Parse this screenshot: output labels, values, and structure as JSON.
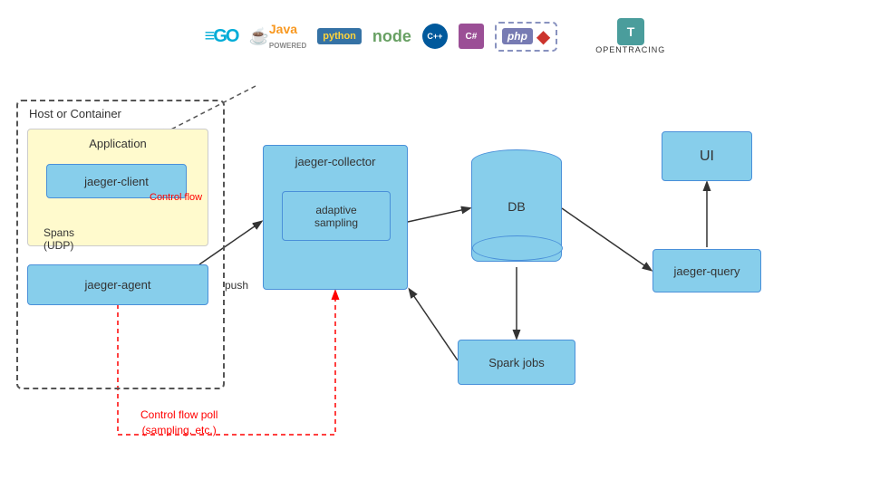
{
  "logos": {
    "go": "≡GO",
    "java": "☕ Java",
    "python": "python",
    "node": "node",
    "cpp": "C++",
    "csharp": "C#",
    "php": "php",
    "ruby": "◆",
    "opentracing": "OPENTRACING"
  },
  "diagram": {
    "host_label": "Host or Container",
    "app_label": "Application",
    "jaeger_client": "jaeger-client",
    "jaeger_agent": "jaeger-agent",
    "spans_label": "Spans\n(UDP)",
    "control_flow": "Control flow",
    "jaeger_collector": "jaeger-collector",
    "adaptive_sampling": "adaptive\nsampling",
    "db": "DB",
    "spark_jobs": "Spark jobs",
    "jaeger_query": "jaeger-query",
    "ui": "UI",
    "push_label": "push",
    "control_flow_poll": "Control flow poll\n(sampling, etc.)"
  },
  "colors": {
    "blue_box": "#87CEEB",
    "blue_border": "#4a90d9",
    "red": "#CC0000",
    "dashed_border": "#555555"
  }
}
